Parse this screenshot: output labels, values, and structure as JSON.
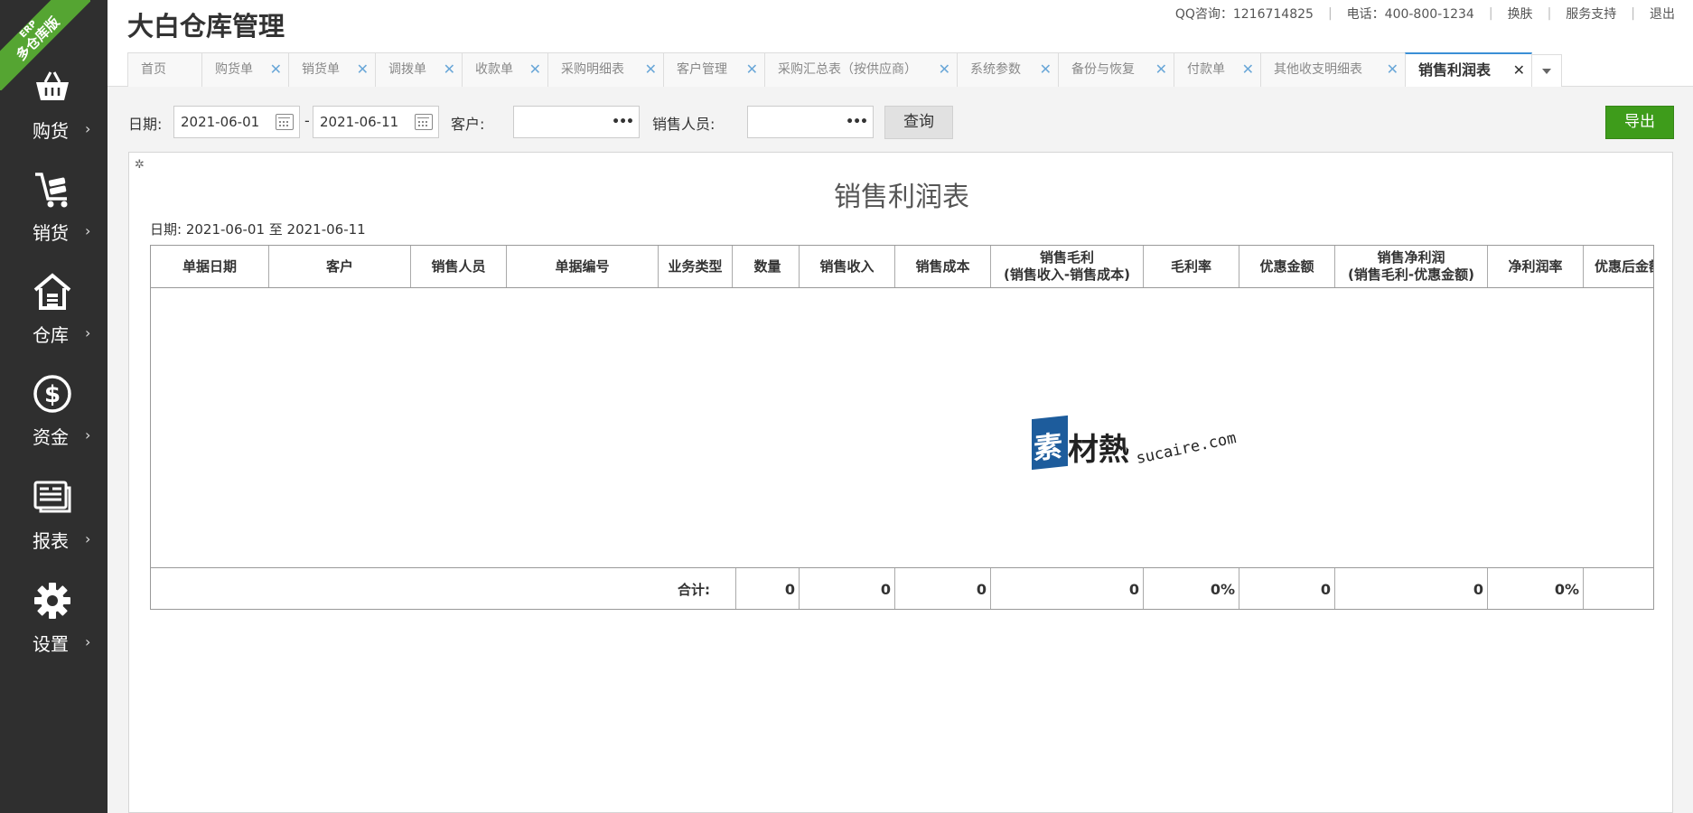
{
  "sidebar": {
    "ribbon_small": "ERP",
    "ribbon_main": "多仓库版",
    "items": [
      {
        "label": "购货",
        "icon": "basket-icon"
      },
      {
        "label": "销货",
        "icon": "cart-icon"
      },
      {
        "label": "仓库",
        "icon": "warehouse-icon"
      },
      {
        "label": "资金",
        "icon": "dollar-icon"
      },
      {
        "label": "报表",
        "icon": "report-icon"
      },
      {
        "label": "设置",
        "icon": "gear-icon"
      }
    ],
    "chevron": "›"
  },
  "header": {
    "title": "大白仓库管理",
    "qq": "QQ咨询：1216714825",
    "phone": "电话：400-800-1234",
    "skin": "换肤",
    "support": "服务支持",
    "logout": "退出"
  },
  "tabs": [
    {
      "label": "首页",
      "closable": false
    },
    {
      "label": "购货单",
      "closable": true
    },
    {
      "label": "销货单",
      "closable": true
    },
    {
      "label": "调拨单",
      "closable": true
    },
    {
      "label": "收款单",
      "closable": true
    },
    {
      "label": "采购明细表",
      "closable": true
    },
    {
      "label": "客户管理",
      "closable": true
    },
    {
      "label": "采购汇总表（按供应商）",
      "closable": true
    },
    {
      "label": "系统参数",
      "closable": true
    },
    {
      "label": "备份与恢复",
      "closable": true
    },
    {
      "label": "付款单",
      "closable": true
    },
    {
      "label": "其他收支明细表",
      "closable": true
    },
    {
      "label": "销售利润表",
      "closable": true,
      "active": true
    }
  ],
  "close_glyph": "✕",
  "filters": {
    "date_label": "日期:",
    "date_from": "2021-06-01",
    "date_sep": "-",
    "date_to": "2021-06-11",
    "customer_label": "客户:",
    "customer_value": "",
    "salesperson_label": "销售人员:",
    "salesperson_value": "",
    "more_glyph": "•••",
    "query_button": "查询",
    "export_button": "导出"
  },
  "report": {
    "title": "销售利润表",
    "date_range": "日期: 2021-06-01 至 2021-06-11",
    "columns": [
      "单据日期",
      "客户",
      "销售人员",
      "单据编号",
      "业务类型",
      "数量",
      "销售收入",
      "销售成本",
      "销售毛利\n(销售收入-销售成本)",
      "毛利率",
      "优惠金额",
      "销售净利润\n(销售毛利-优惠金额)",
      "净利润率",
      "优惠后金额"
    ],
    "footer": {
      "total_label": "合计:",
      "values": [
        "0",
        "0",
        "0",
        "0",
        "0%",
        "0",
        "0",
        "0%",
        ""
      ]
    }
  },
  "watermark": {
    "mark": "素",
    "brand": "材熱",
    "domain": "sucaire.com"
  },
  "colors": {
    "sidebar_bg": "#2f2f2f",
    "ribbon": "#55a532",
    "export_button": "#3e9c1b",
    "active_tab_border": "#3a8fd6",
    "tab_close": "#6aa7d8"
  }
}
